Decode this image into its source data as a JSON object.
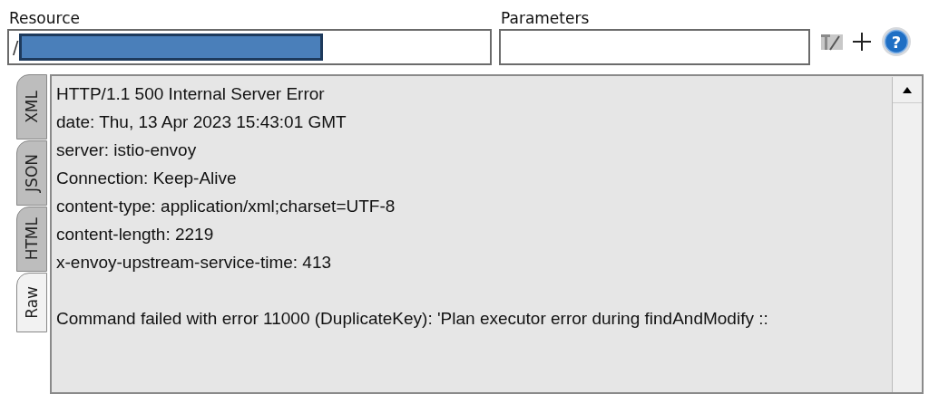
{
  "resource": {
    "label": "Resource",
    "value": "/",
    "redacted": true
  },
  "parameters": {
    "label": "Parameters"
  },
  "help_button": {
    "glyph": "?"
  },
  "tabs": [
    {
      "label": "XML",
      "selected": false
    },
    {
      "label": "JSON",
      "selected": false
    },
    {
      "label": "HTML",
      "selected": false
    },
    {
      "label": "Raw",
      "selected": true
    }
  ],
  "response_headers": [
    "HTTP/1.1 500 Internal Server Error",
    "date: Thu, 13 Apr 2023 15:43:01 GMT",
    "server: istio-envoy",
    "Connection: Keep-Alive",
    "content-type: application/xml;charset=UTF-8",
    "content-length: 2219",
    "x-envoy-upstream-service-time: 413"
  ],
  "response_body": [
    "Command failed with error 11000 (DuplicateKey): 'Plan executor error during findAndModify ::"
  ]
}
